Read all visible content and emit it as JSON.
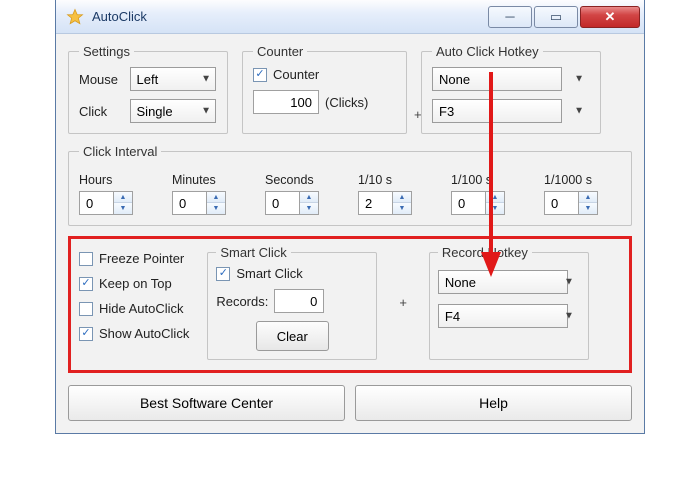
{
  "window": {
    "title": "AutoClick"
  },
  "settings": {
    "legend": "Settings",
    "mouse_label": "Mouse",
    "mouse_value": "Left",
    "click_label": "Click",
    "click_value": "Single"
  },
  "counter": {
    "legend": "Counter",
    "checkbox_label": "Counter",
    "checked": true,
    "value": "100",
    "suffix": "(Clicks)"
  },
  "hotkey": {
    "legend": "Auto Click Hotkey",
    "mod": "None",
    "plus": "+",
    "key": "F3"
  },
  "interval": {
    "legend": "Click Interval",
    "labels": [
      "Hours",
      "Minutes",
      "Seconds",
      "1/10 s",
      "1/100 s",
      "1/1000 s"
    ],
    "values": [
      "0",
      "0",
      "0",
      "2",
      "0",
      "0"
    ]
  },
  "options": {
    "freeze": {
      "label": "Freeze Pointer",
      "checked": false
    },
    "keep_top": {
      "label": "Keep on Top",
      "checked": true
    },
    "hide": {
      "label": "Hide AutoClick",
      "checked": false
    },
    "show": {
      "label": "Show AutoClick",
      "checked": true
    }
  },
  "smart": {
    "legend": "Smart Click",
    "checkbox_label": "Smart Click",
    "checked": true,
    "records_label": "Records:",
    "records_value": "0",
    "clear_label": "Clear"
  },
  "record_hotkey": {
    "legend": "Record Hotkey",
    "mod": "None",
    "plus": "+",
    "key": "F4"
  },
  "buttons": {
    "best": "Best Software Center",
    "help": "Help"
  }
}
